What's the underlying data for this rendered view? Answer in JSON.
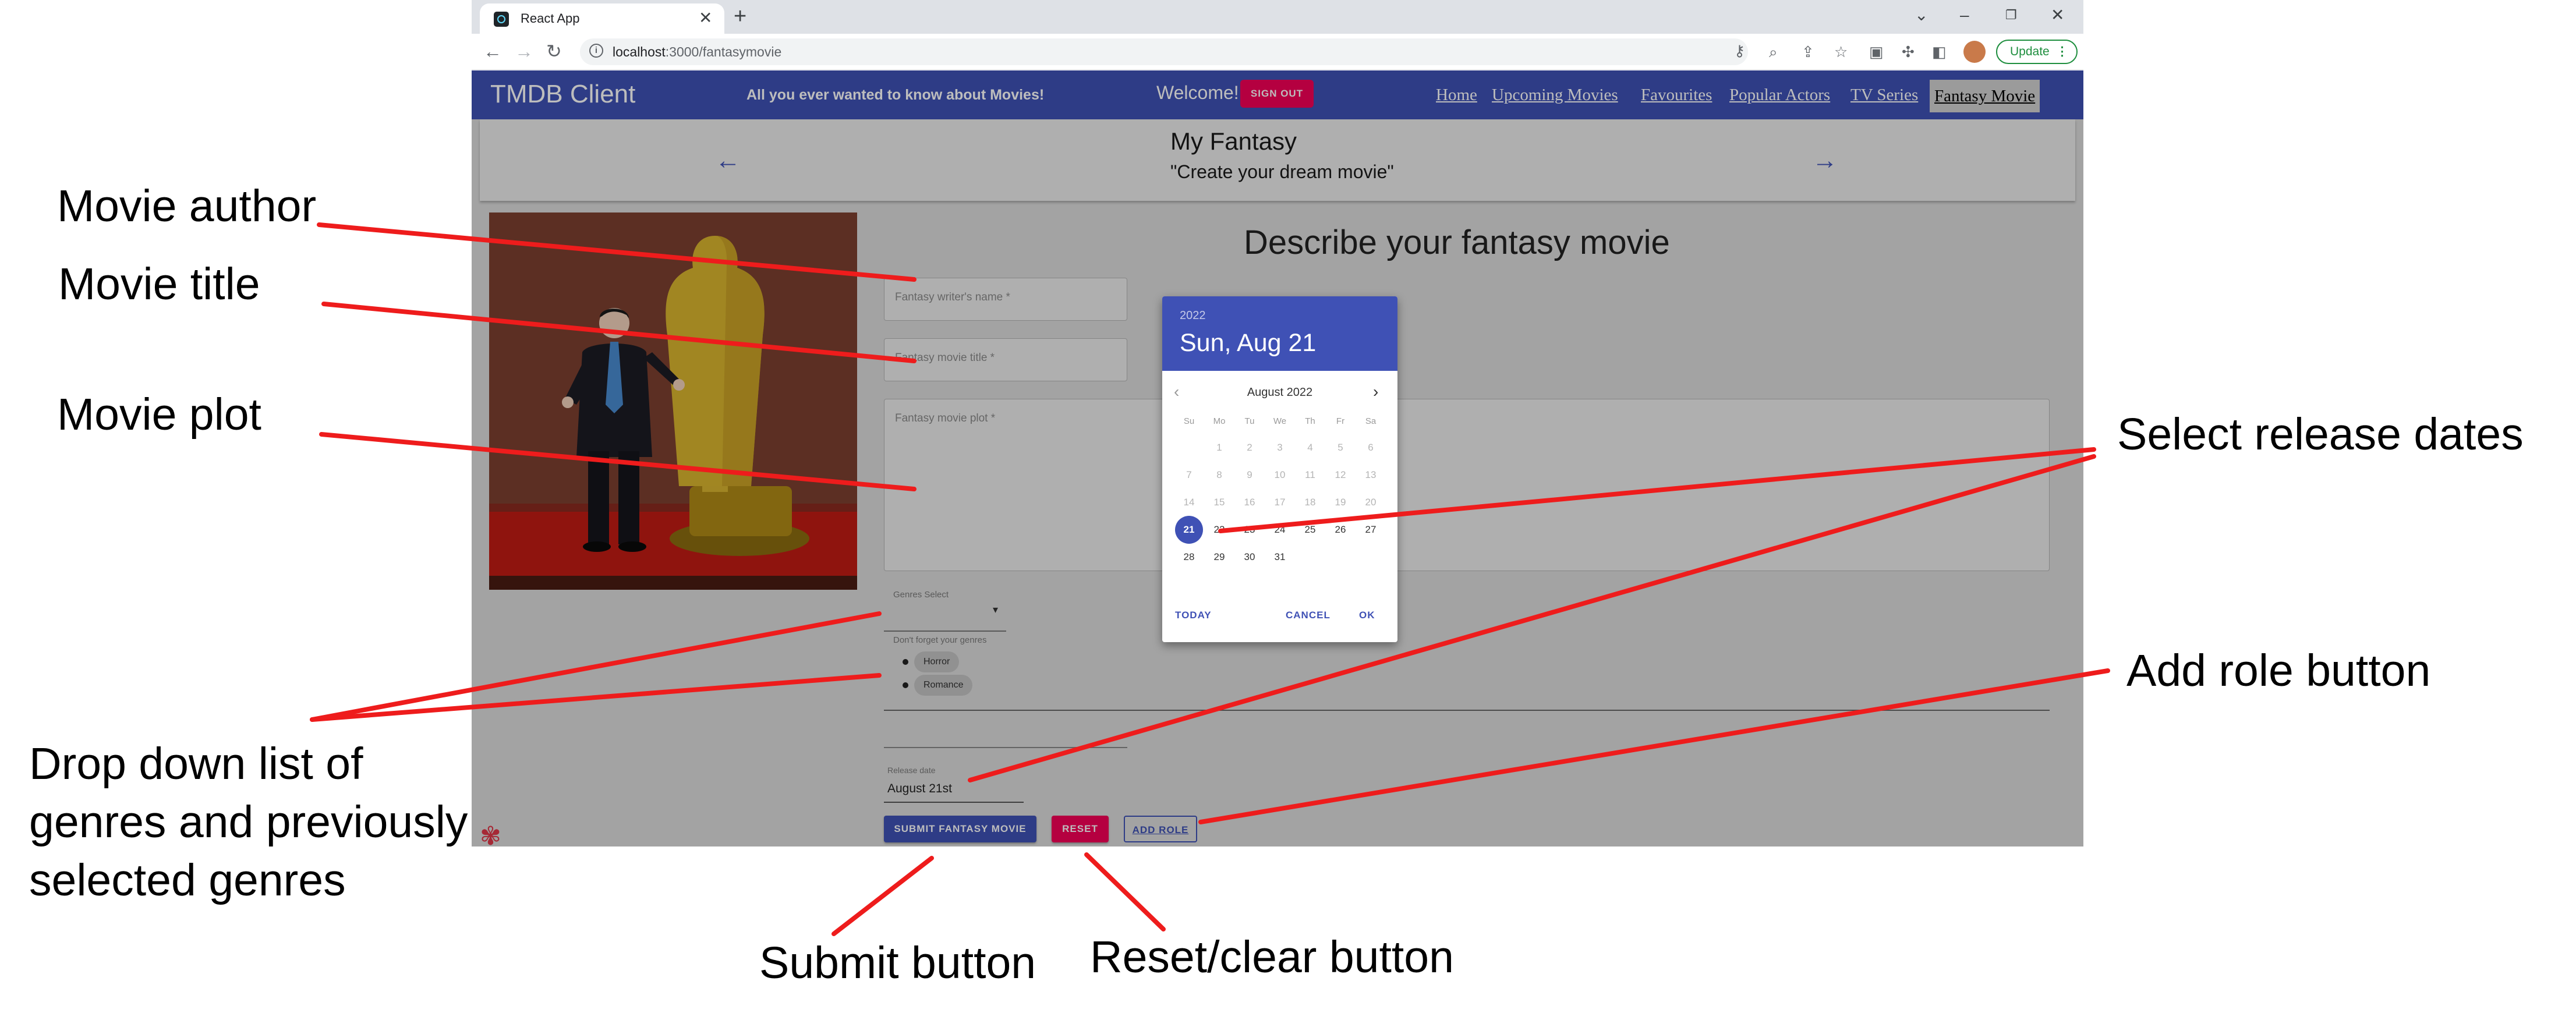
{
  "browser": {
    "tab_title": "React App",
    "tab_close": "✕",
    "new_tab": "+",
    "url_host": "localhost",
    "url_path": ":3000/fantasymovie",
    "update_label": "Update"
  },
  "app": {
    "brand": "TMDB Client",
    "tagline": "All you ever wanted to know about Movies!",
    "welcome": "Welcome!",
    "signout_label": "SIGN OUT",
    "nav": [
      "Home",
      "Upcoming Movies",
      "Favourites",
      "Popular Actors",
      "TV Series",
      "Fantasy Movie"
    ]
  },
  "header": {
    "title": "My Fantasy",
    "subtitle": "\"Create your dream movie\"",
    "left_arrow": "←",
    "right_arrow": "→"
  },
  "form": {
    "title": "Describe your fantasy movie",
    "writer_placeholder": "Fantasy writer's name *",
    "title_placeholder": "Fantasy movie title *",
    "plot_placeholder": "Fantasy movie plot *",
    "genres_label": "Genres Select",
    "genres_helper": "Don't forget your genres",
    "selected_genres": [
      "Horror",
      "Romance"
    ],
    "release_label": "Release date",
    "release_value": "August 21st",
    "submit_label": "SUBMIT FANTASY MOVIE",
    "reset_label": "RESET",
    "addrole_label": "ADD ROLE"
  },
  "datepicker": {
    "year": "2022",
    "selected_date": "Sun, Aug 21",
    "month_label": "August 2022",
    "weekdays": [
      "Su",
      "Mo",
      "Tu",
      "We",
      "Th",
      "Fr",
      "Sa"
    ],
    "days": [
      [
        "",
        "1",
        "2",
        "3",
        "4",
        "5",
        "6"
      ],
      [
        "7",
        "8",
        "9",
        "10",
        "11",
        "12",
        "13"
      ],
      [
        "14",
        "15",
        "16",
        "17",
        "18",
        "19",
        "20"
      ],
      [
        "21",
        "22",
        "23",
        "24",
        "25",
        "26",
        "27"
      ],
      [
        "28",
        "29",
        "30",
        "31",
        "",
        "",
        ""
      ]
    ],
    "selected_day": "21",
    "today_label": "TODAY",
    "cancel_label": "CANCEL",
    "ok_label": "OK"
  },
  "annotations": {
    "movie_author": "Movie author",
    "movie_title": "Movie title",
    "movie_plot": "Movie plot",
    "genres_line1": "Drop down list of",
    "genres_line2": "genres and previously",
    "genres_line3": "selected genres",
    "release_dates": "Select release dates",
    "add_role": "Add role button",
    "submit": "Submit button",
    "reset": "Reset/clear button"
  },
  "colors": {
    "app_bar": "#3f51b5",
    "accent_pink": "#f50057",
    "annotation_line": "#ee1c1c"
  }
}
